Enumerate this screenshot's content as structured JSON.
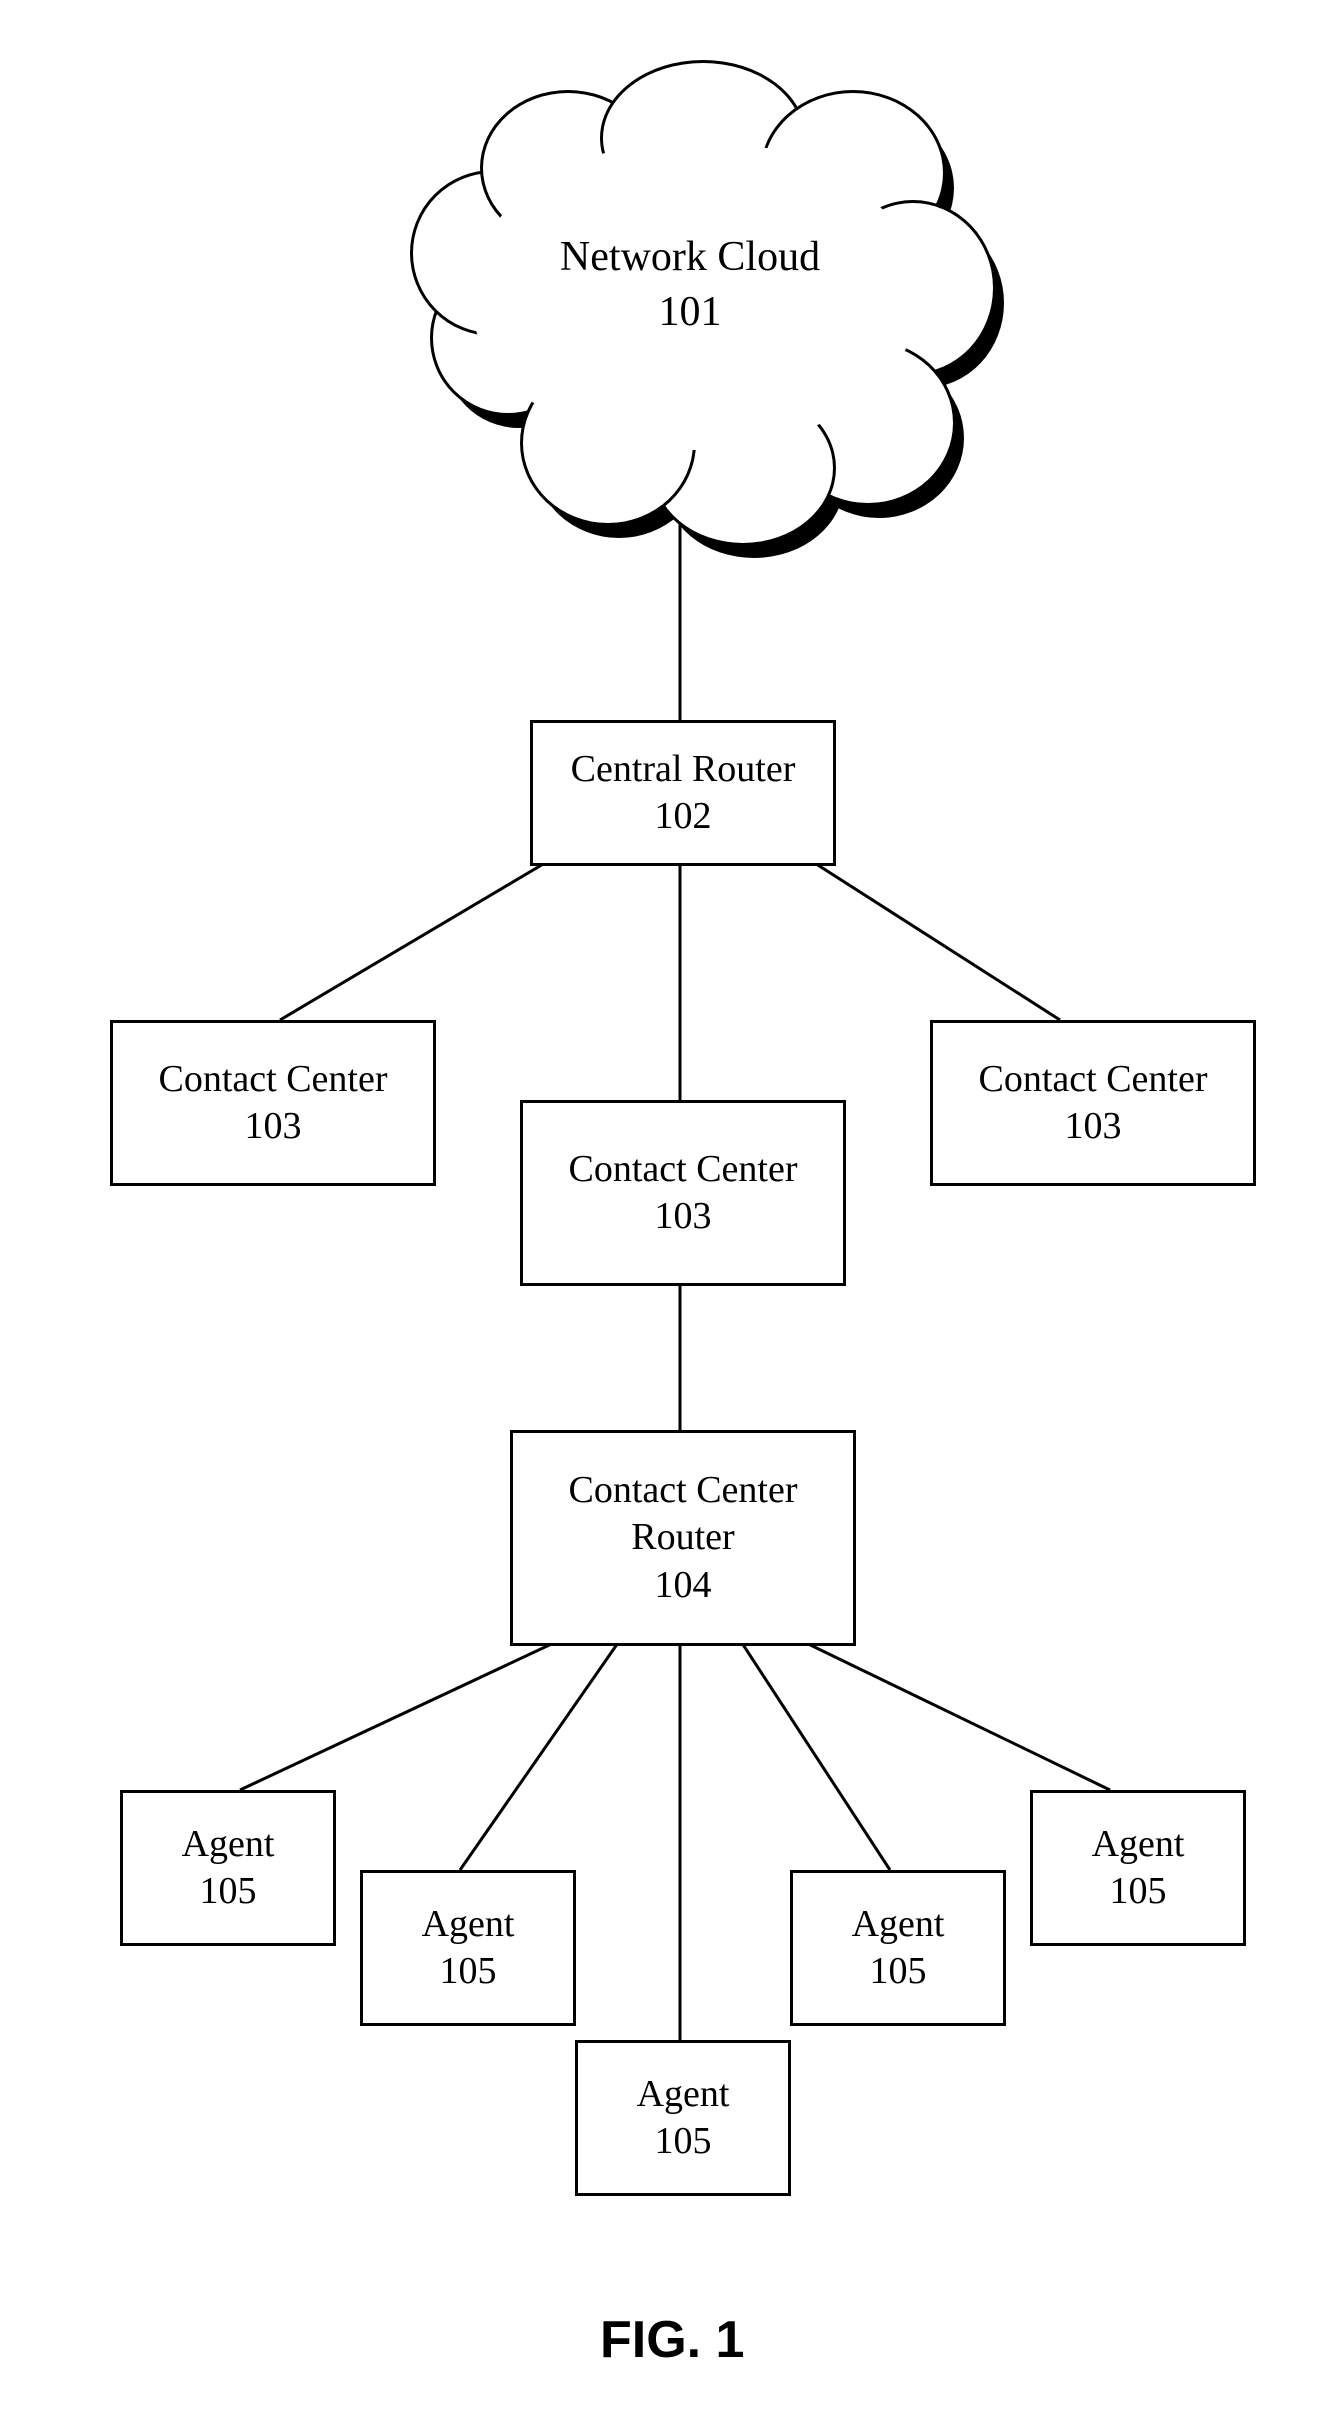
{
  "figure_label": "FIG. 1",
  "nodes": {
    "cloud": {
      "label": "Network Cloud",
      "num": "101"
    },
    "central_router": {
      "label": "Central Router",
      "num": "102"
    },
    "contact_center_left": {
      "label": "Contact Center",
      "num": "103"
    },
    "contact_center_mid": {
      "label": "Contact Center",
      "num": "103"
    },
    "contact_center_right": {
      "label": "Contact Center",
      "num": "103"
    },
    "cc_router": {
      "label": "Contact Center Router",
      "num": "104"
    },
    "agent_1": {
      "label": "Agent",
      "num": "105"
    },
    "agent_2": {
      "label": "Agent",
      "num": "105"
    },
    "agent_3": {
      "label": "Agent",
      "num": "105"
    },
    "agent_4": {
      "label": "Agent",
      "num": "105"
    },
    "agent_5": {
      "label": "Agent",
      "num": "105"
    }
  }
}
